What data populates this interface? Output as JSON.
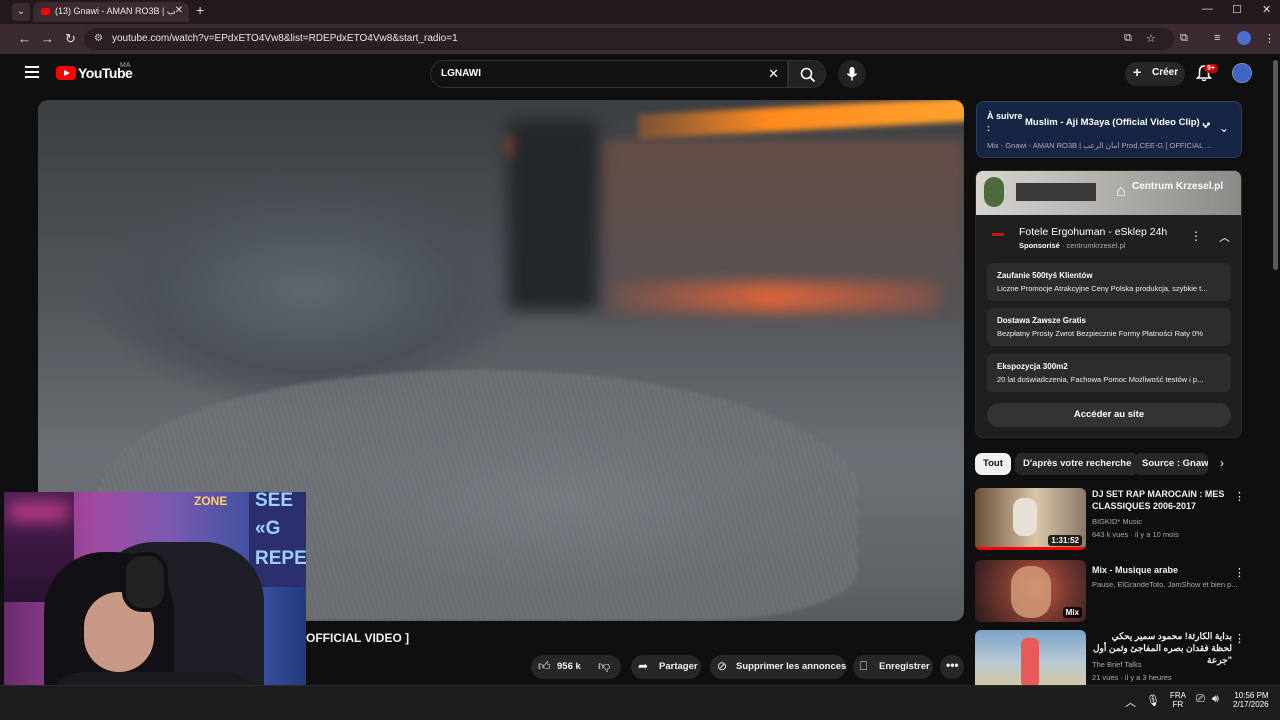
{
  "browser": {
    "tab_title": "(13) Gnawi - AMAN RO3B | عب",
    "tab_close": "✕",
    "new_tab": "+",
    "url": "youtube.com/watch?v=EPdxETO4Vw8&list=RDEPdxETO4Vw8&start_radio=1",
    "window_controls": {
      "minimize": "—",
      "maximize": "☐",
      "close": "✕"
    }
  },
  "youtube": {
    "logo_text": "YouTube",
    "country_code": "MA",
    "search_query": "LGNAWI",
    "create_label": "Créer",
    "notification_count": "9+"
  },
  "video": {
    "title_visible": "OFFICIAL VIDEO ]",
    "likes": "956 k",
    "share_label": "Partager",
    "remove_ads_label": "Supprimer les annonces",
    "save_label": "Enregistrer"
  },
  "up_next": {
    "label": "À suivre :",
    "title": "Muslim - Aji M3aya (Official Video Clip) مسلم - آجي",
    "subtitle": "Mix - Gnawi - AMAN RO3B | امان الرعب Prod.CEE-G [ OFFICIAL ..."
  },
  "ad": {
    "brand": "Centrum Krzesel.pl",
    "title": "Fotele Ergohuman - eSklep 24h",
    "sponsored": "Sponsorisé",
    "domain": "centrumkrzesel.pl",
    "cards": [
      {
        "heading": "Zaufanie 500tyś Klientów",
        "desc": "Liczne Promocje Atrakcyjne Ceny Polska produkcja, szybkie t..."
      },
      {
        "heading": "Dostawa Zawsze Gratis",
        "desc": "Bezpłatny Prosty Zwrot Bezpiecznie Formy Płatności Raty 0%"
      },
      {
        "heading": "Ekspozycja 300m2",
        "desc": "20 lat doświadczenia, Fachowa Pomoc Możliwość testów i p..."
      }
    ],
    "cta": "Accéder au site"
  },
  "chips": [
    "Tout",
    "D'après votre recherche",
    "Source : Gnawi"
  ],
  "recommendations": [
    {
      "title": "DJ SET RAP MAROCAIN : MES CLASSIQUES 2006-2017",
      "channel": "BIGKID* Music",
      "meta": "643 k vues · il y a 10 mois",
      "duration": "1:31:52",
      "thumb_colors": [
        "#6b4f3a",
        "#d9c7a8"
      ]
    },
    {
      "title": "Mix - Musique arabe",
      "channel": "Pause, ElGrandeToto, JamShow et bien p...",
      "meta": "",
      "duration": "Mix",
      "thumb_colors": [
        "#4a2a24",
        "#c85a44"
      ]
    },
    {
      "title": "بداية الكارثة! محمود سمير يحكي لحظة فقدان بصره المفاجئ وثمن أول \"جرعة",
      "channel": "The Brief Talks",
      "meta": "21 vues · il y a 3 heures",
      "duration": "",
      "thumb_colors": [
        "#7aa3c8",
        "#d8c89a"
      ]
    }
  ],
  "webcam": {
    "sign_text_1": "SEE",
    "sign_text_2": "«G",
    "sign_text_3": "REPE",
    "neon_text": "ZONE"
  },
  "taskbar": {
    "language_1": "FRA",
    "language_2": "FR",
    "time": "10:56 PM",
    "date": "2/17/2026"
  }
}
